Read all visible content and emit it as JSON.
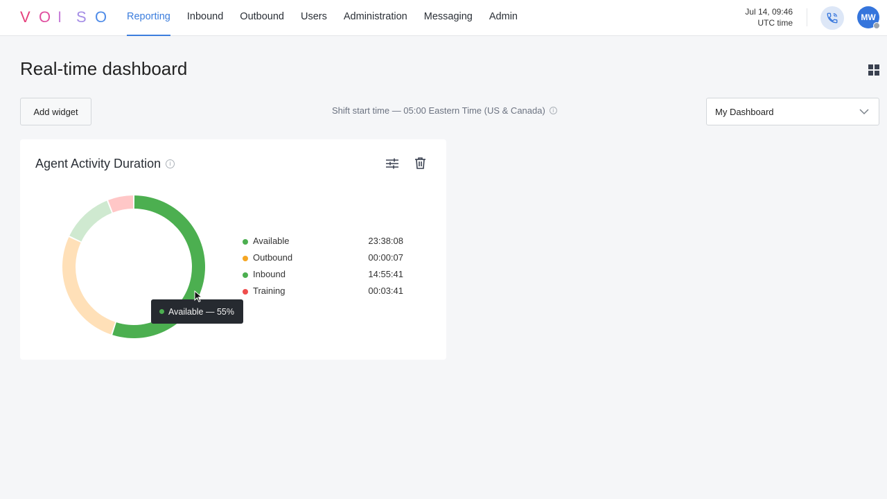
{
  "logo": {
    "letters": [
      "V",
      "O",
      "I",
      "S",
      "O"
    ],
    "colors": [
      "#e6417c",
      "#e04fa0",
      "#c77fd9",
      "#a58ee6",
      "#4f8ce8"
    ]
  },
  "nav": {
    "items": [
      {
        "label": "Reporting",
        "active": true
      },
      {
        "label": "Inbound",
        "active": false
      },
      {
        "label": "Outbound",
        "active": false
      },
      {
        "label": "Users",
        "active": false
      },
      {
        "label": "Administration",
        "active": false
      },
      {
        "label": "Messaging",
        "active": false
      },
      {
        "label": "Admin",
        "active": false
      }
    ],
    "accent": "#3b7ddd"
  },
  "header": {
    "datetime": "Jul 14, 09:46",
    "timezone": "UTC time",
    "phone_icon": "phone-icon",
    "avatar_initials": "MW",
    "avatar_color": "#3575dc"
  },
  "page": {
    "title": "Real-time dashboard",
    "add_widget_label": "Add widget",
    "shift_text": "Shift start time — 05:00 Eastern Time (US & Canada)",
    "dashboard_select": "My Dashboard",
    "layout_icon": "grid-icon"
  },
  "widget": {
    "title": "Agent Activity Duration",
    "settings_icon": "sliders-icon",
    "delete_icon": "trash-icon",
    "legend": [
      {
        "label": "Available",
        "duration": "23:38:08",
        "color": "#4caf50"
      },
      {
        "label": "Outbound",
        "duration": "00:00:07",
        "color": "#f5a623"
      },
      {
        "label": "Inbound",
        "duration": "14:55:41",
        "color": "#4caf50"
      },
      {
        "label": "Training",
        "duration": "00:03:41",
        "color": "#ef4d4d"
      }
    ],
    "tooltip": "Available — 55%"
  },
  "chart_data": {
    "type": "pie",
    "variant": "donut",
    "categories": [
      "Available",
      "Outbound",
      "Inbound",
      "Training"
    ],
    "values": [
      55,
      27,
      12,
      6
    ],
    "colors": [
      "#4caf50",
      "#ffe0b8",
      "#cfe9d0",
      "#ffc7c7"
    ],
    "highlighted": "Available"
  }
}
